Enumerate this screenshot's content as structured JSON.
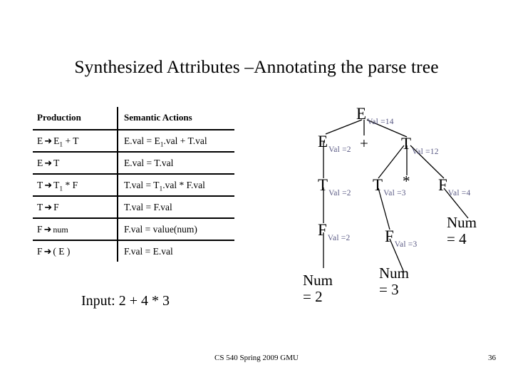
{
  "slide": {
    "title": "Synthesized Attributes –Annotating the parse tree",
    "input_label": "Input: 2 + 4 * 3"
  },
  "table": {
    "headers": {
      "production": "Production",
      "semantic_actions": "Semantic Actions"
    },
    "rows": [
      {
        "production_lhs": "E",
        "arrow": "➜",
        "production_rhs_pre": "E",
        "production_rhs_sub": "1",
        "production_rhs_post": " + T",
        "action_pre": "E.val = E",
        "action_sub": "1",
        "action_post": ".val + T.val"
      },
      {
        "production_lhs": "E",
        "arrow": "➜",
        "production_rhs_pre": "T",
        "production_rhs_sub": "",
        "production_rhs_post": "",
        "action_pre": "E.val = T.val",
        "action_sub": "",
        "action_post": ""
      },
      {
        "production_lhs": "T",
        "arrow": "➜",
        "production_rhs_pre": "T",
        "production_rhs_sub": "1",
        "production_rhs_post": " * F",
        "action_pre": "T.val = T",
        "action_sub": "1",
        "action_post": ".val * F.val"
      },
      {
        "production_lhs": "T",
        "arrow": "➜",
        "production_rhs_pre": "F",
        "production_rhs_sub": "",
        "production_rhs_post": "",
        "action_pre": "T.val = F.val",
        "action_sub": "",
        "action_post": ""
      },
      {
        "production_lhs": "F",
        "arrow": "➜",
        "production_rhs_pre": "num",
        "production_rhs_sub": "",
        "production_rhs_post": "",
        "action_pre": "F.val = value(num)",
        "action_sub": "",
        "action_post": ""
      },
      {
        "production_lhs": "F",
        "arrow": "➜",
        "production_rhs_pre": "( E )",
        "production_rhs_sub": "",
        "production_rhs_post": "",
        "action_pre": "F.val = E.val",
        "action_sub": "",
        "action_post": ""
      }
    ]
  },
  "tree": {
    "annotation_color": "#5a5a84",
    "nodes": {
      "root_e": {
        "symbol": "E",
        "val": "Val =14"
      },
      "e_left": {
        "symbol": "E",
        "val": "Val =2"
      },
      "plus": {
        "symbol": "+"
      },
      "t_right": {
        "symbol": "T",
        "val": "Val =12"
      },
      "t_left": {
        "symbol": "T",
        "val": "Val =2"
      },
      "t_mid": {
        "symbol": "T",
        "val": "Val =3"
      },
      "star": {
        "symbol": "*"
      },
      "f_right": {
        "symbol": "F",
        "val": "Val =4"
      },
      "f_left": {
        "symbol": "F",
        "val": "Val =2"
      },
      "f_mid": {
        "symbol": "F",
        "val": "Val =3"
      },
      "num_left_l1": {
        "text": "Num"
      },
      "num_left_l2": {
        "text": "= 2"
      },
      "num_mid_l1": {
        "text": "Num"
      },
      "num_mid_l2": {
        "text": "= 3"
      },
      "num_right_l1": {
        "text": "Num"
      },
      "num_right_l2": {
        "text": "= 4"
      }
    }
  },
  "footer": {
    "course": "CS 540 Spring 2009 GMU",
    "page": "36"
  }
}
